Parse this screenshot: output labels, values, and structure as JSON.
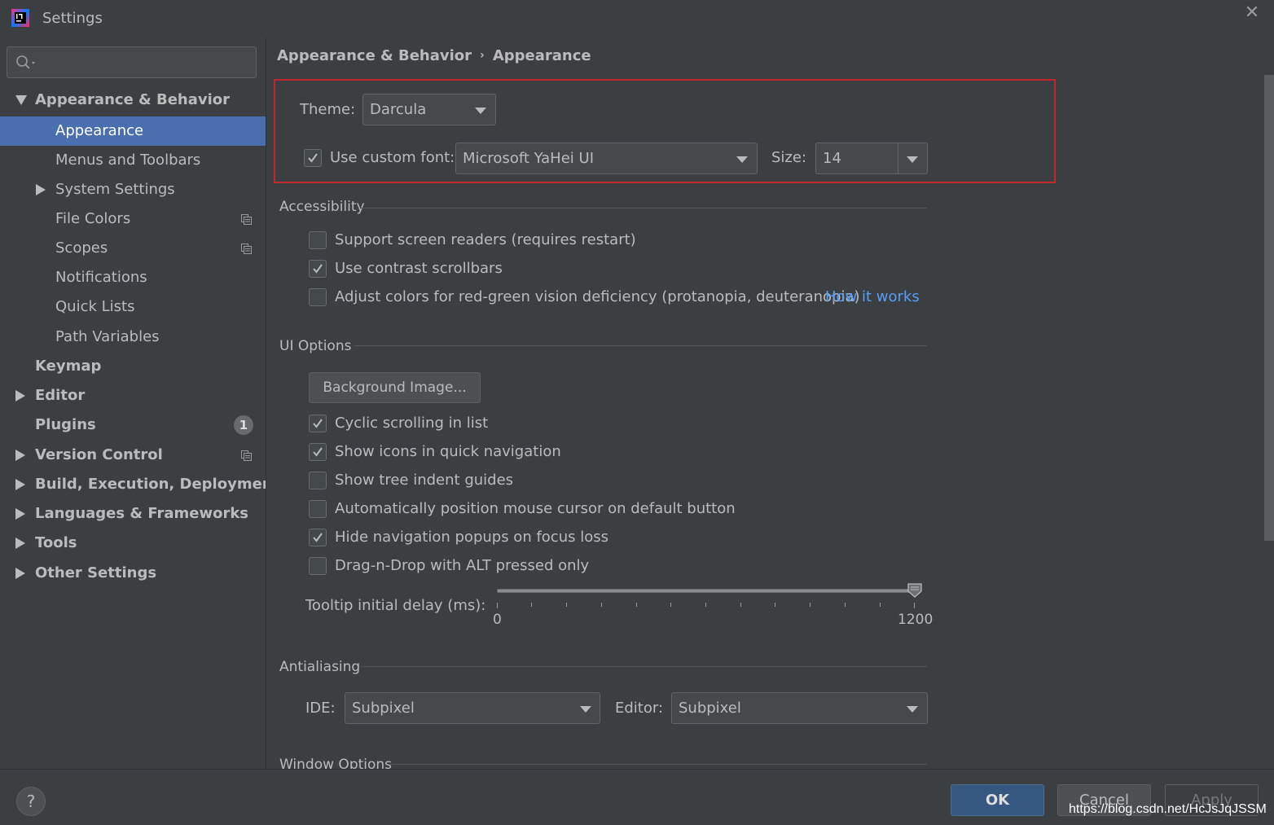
{
  "window": {
    "title": "Settings",
    "close_icon": "close-icon"
  },
  "sidebar": {
    "search": {
      "value": "",
      "placeholder": ""
    },
    "items": [
      {
        "label": "Appearance & Behavior",
        "expanded": true
      },
      {
        "label": "Appearance",
        "selected": true
      },
      {
        "label": "Menus and Toolbars"
      },
      {
        "label": "System Settings"
      },
      {
        "label": "File Colors"
      },
      {
        "label": "Scopes"
      },
      {
        "label": "Notifications"
      },
      {
        "label": "Quick Lists"
      },
      {
        "label": "Path Variables"
      },
      {
        "label": "Keymap"
      },
      {
        "label": "Editor"
      },
      {
        "label": "Plugins",
        "badge": "1"
      },
      {
        "label": "Version Control"
      },
      {
        "label": "Build, Execution, Deployment"
      },
      {
        "label": "Languages & Frameworks"
      },
      {
        "label": "Tools"
      },
      {
        "label": "Other Settings"
      }
    ]
  },
  "breadcrumb": {
    "parent": "Appearance & Behavior",
    "separator": "›",
    "current": "Appearance"
  },
  "theme": {
    "label": "Theme:",
    "value": "Darcula"
  },
  "font": {
    "checkbox_label": "Use custom font:",
    "checked": true,
    "value": "Microsoft YaHei UI",
    "size_label": "Size:",
    "size_value": "14"
  },
  "accessibility": {
    "title": "Accessibility",
    "options": [
      {
        "label": "Support screen readers (requires restart)",
        "checked": false
      },
      {
        "label": "Use contrast scrollbars",
        "checked": true
      },
      {
        "label": "Adjust colors for red-green vision deficiency (protanopia, deuteranopia)",
        "checked": false
      }
    ],
    "how_it_works": "How it works"
  },
  "ui_options": {
    "title": "UI Options",
    "background_button": "Background Image...",
    "options": [
      {
        "label": "Cyclic scrolling in list",
        "checked": true
      },
      {
        "label": "Show icons in quick navigation",
        "checked": true
      },
      {
        "label": "Show tree indent guides",
        "checked": false
      },
      {
        "label": "Automatically position mouse cursor on default button",
        "checked": false
      },
      {
        "label": "Hide navigation popups on focus loss",
        "checked": true
      },
      {
        "label": "Drag-n-Drop with ALT pressed only",
        "checked": false
      }
    ],
    "tooltip": {
      "label": "Tooltip initial delay (ms):",
      "min_label": "0",
      "max_label": "1200",
      "value": 1200
    }
  },
  "antialiasing": {
    "title": "Antialiasing",
    "ide_label": "IDE:",
    "ide_value": "Subpixel",
    "editor_label": "Editor:",
    "editor_value": "Subpixel"
  },
  "window_options": {
    "title": "Window Options"
  },
  "footer": {
    "help": "?",
    "ok": "OK",
    "cancel": "Cancel",
    "apply": "Apply",
    "watermark": "https://blog.csdn.net/HcJsJqJSSM"
  },
  "colors": {
    "background": "#3c3f41",
    "selection": "#4b6eaf",
    "link": "#589df6",
    "highlight_box": "#c4262e",
    "ok_button": "#365880"
  }
}
